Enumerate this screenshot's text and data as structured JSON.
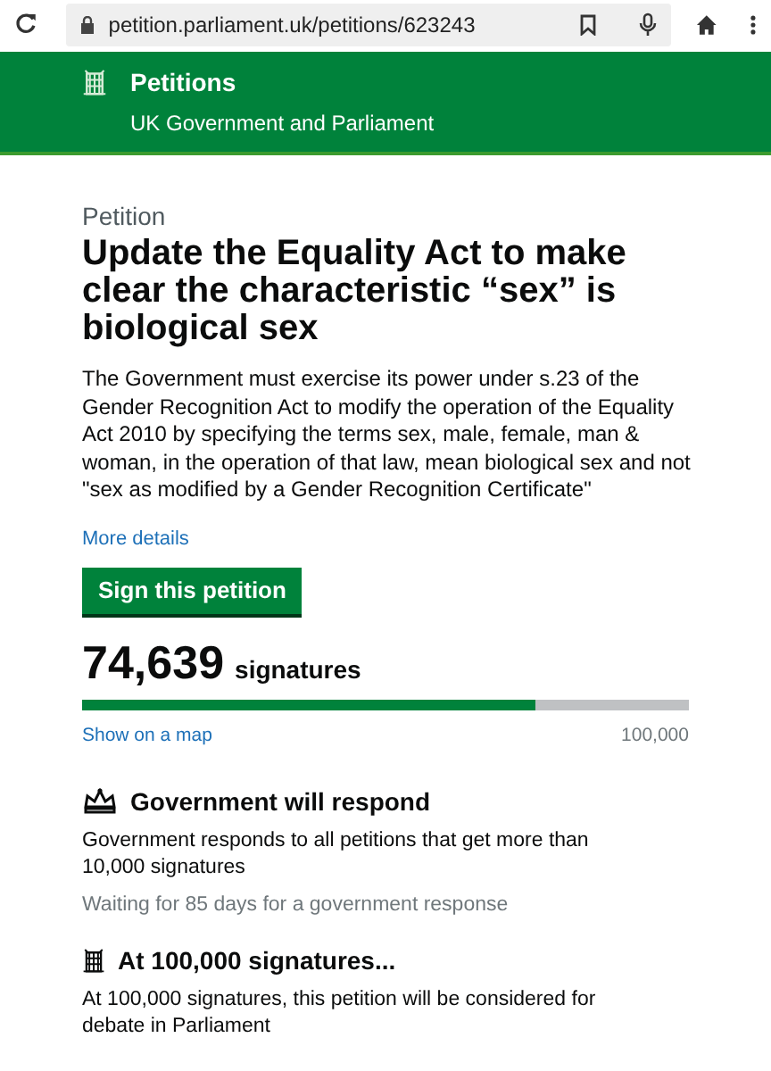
{
  "browser": {
    "url": "petition.parliament.uk/petitions/623243"
  },
  "header": {
    "title": "Petitions",
    "subtitle": "UK Government and Parliament"
  },
  "petition": {
    "label": "Petition",
    "title": "Update the Equality Act to make clear the characteristic “sex” is biological sex",
    "description": "The Government must exercise its power under s.23 of the Gender Recognition Act to modify the operation of the Equality Act 2010 by specifying the terms sex, male, female, man & woman, in the operation of that law, mean biological sex and not \"sex as modified by a Gender Recognition Certificate\"",
    "more_link": "More details",
    "sign_button": "Sign this petition"
  },
  "signatures": {
    "count": "74,639",
    "unit": "signatures",
    "level": 0.746,
    "map_link": "Show on a map",
    "target": "100,000"
  },
  "thresholds": [
    {
      "kind": "crown",
      "heading": "Government will respond",
      "text": "Government responds to all petitions that get more than 10,000 signatures",
      "note": "Waiting for 85 days for a government response"
    },
    {
      "kind": "portcullis",
      "heading": "At 100,000 signatures...",
      "text": "At 100,000 signatures, this petition will be considered for debate in Parliament"
    }
  ]
}
